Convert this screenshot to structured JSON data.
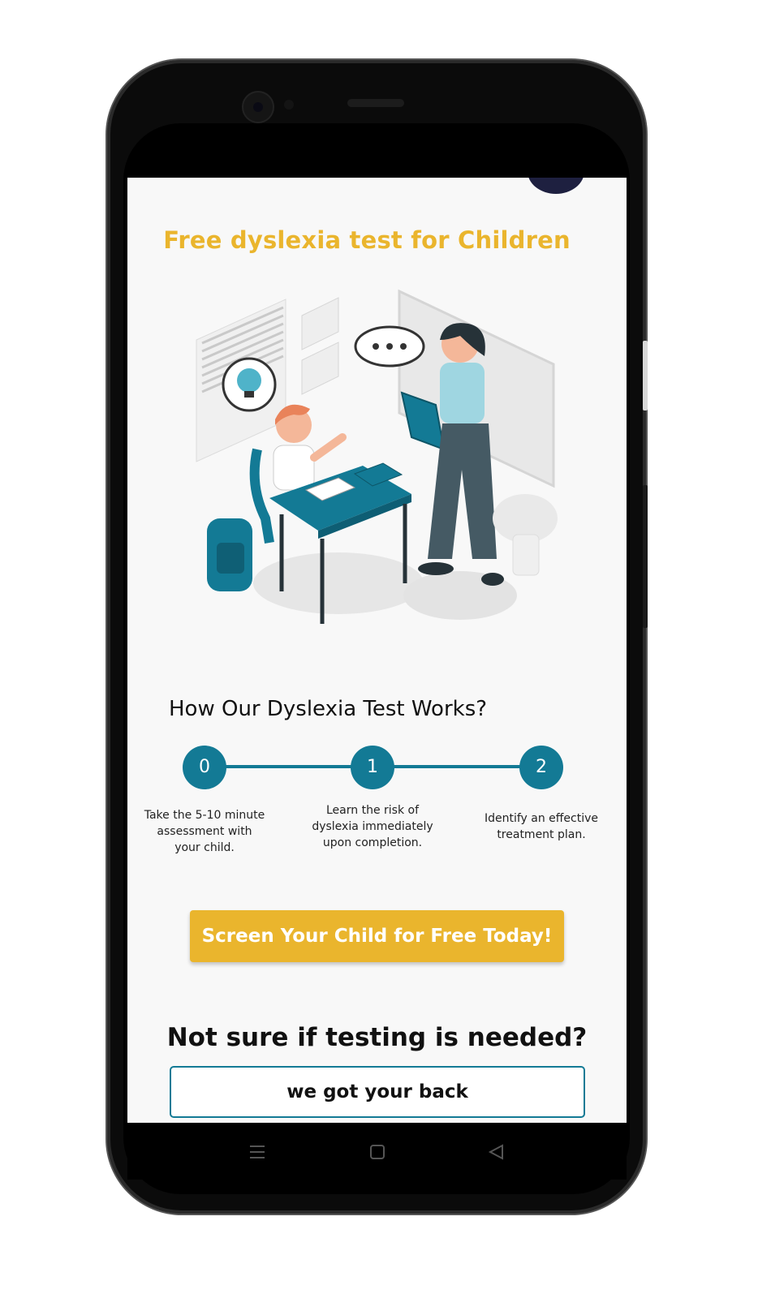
{
  "page": {
    "title": "Free dyslexia test for Children",
    "how_title": "How Our Dyslexia Test Works?",
    "steps": [
      {
        "number": "0",
        "text": "Take the 5-10 minute assessment with your child."
      },
      {
        "number": "1",
        "text": "Learn the risk of dyslexia immediately upon completion."
      },
      {
        "number": "2",
        "text": "Identify an effective treatment plan."
      }
    ],
    "cta_label": "Screen Your Child for Free Today!",
    "not_sure_heading": "Not sure if testing is needed?",
    "back_label": "we got your back"
  },
  "colors": {
    "accent_yellow": "#eab52d",
    "teal": "#137a95",
    "screen_bg": "#f8f8f8"
  },
  "icons": {
    "illustration": "teacher-student-illustration",
    "nav_recents": "menu-lines-icon",
    "nav_home": "square-home-icon",
    "nav_back": "triangle-back-icon"
  }
}
